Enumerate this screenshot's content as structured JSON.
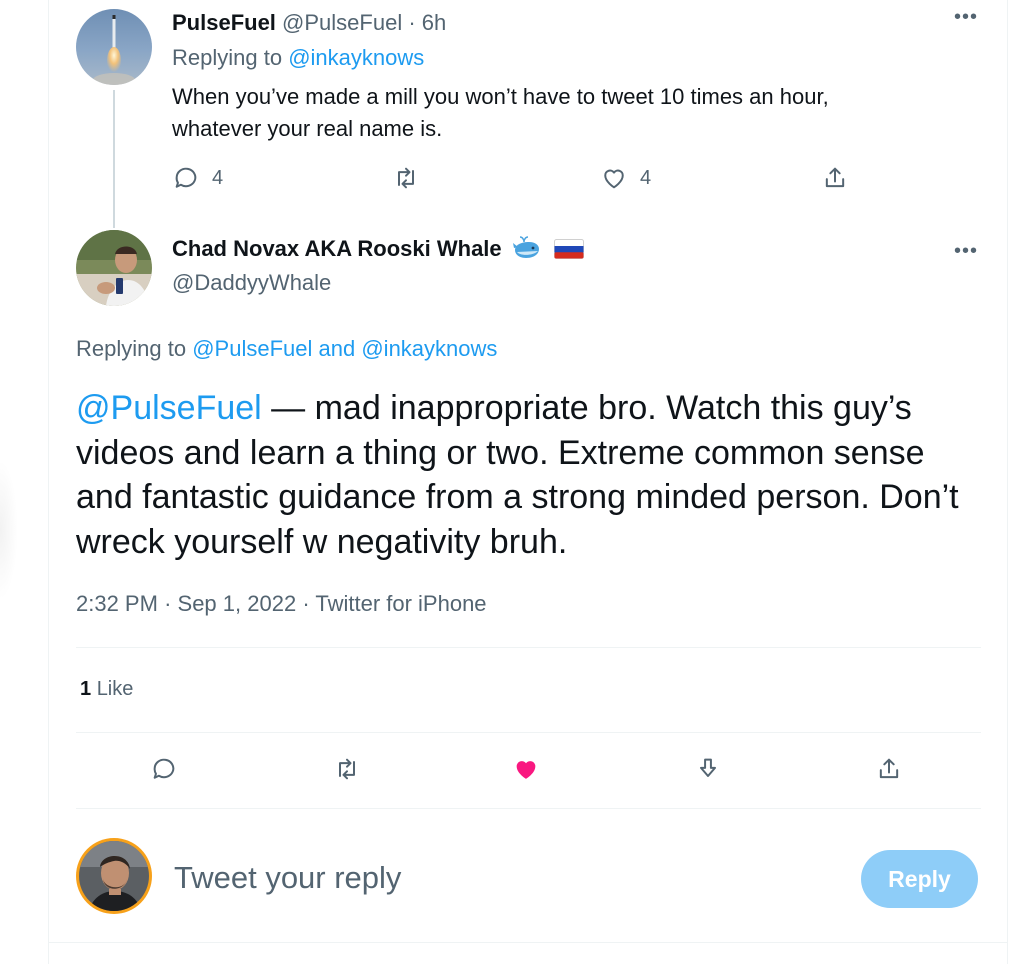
{
  "parent_tweet": {
    "display_name": "PulseFuel",
    "handle": "@PulseFuel",
    "separator": "·",
    "time": "6h",
    "replying_prefix": "Replying to",
    "replying_to": "@inkayknows",
    "text_line1": "When you’ve made a mill you won’t have to tweet 10 times an hour,",
    "text_line2": "whatever your real name is.",
    "reply_count": "4",
    "like_count": "4",
    "more_icon": "more-dots-icon"
  },
  "main_tweet": {
    "display_name": "Chad Novax AKA Rooski Whale",
    "name_emojis": [
      "whale-emoji",
      "russia-flag-emoji"
    ],
    "handle": "@DaddyyWhale",
    "replying_prefix": "Replying to",
    "replying_to_1": "@PulseFuel",
    "replying_and": "and",
    "replying_to_2": "@inkayknows",
    "mention": "@PulseFuel",
    "text": " — mad inappropriate bro. Watch this guy’s videos and learn a thing or two. Extreme common sense and fantastic guidance from a strong minded person. Don’t wreck yourself w negativity bruh.",
    "time": "2:32 PM",
    "dot1": "·",
    "date": "Sep 1, 2022",
    "dot2": "·",
    "source": "Twitter for iPhone",
    "likes_count": "1",
    "likes_label": "Like",
    "liked": true
  },
  "compose": {
    "placeholder": "Tweet your reply",
    "button_label": "Reply"
  },
  "colors": {
    "accent": "#1d9bf0",
    "like": "#f91880",
    "muted": "#536471",
    "reply_button_disabled": "#8ecdf8"
  }
}
